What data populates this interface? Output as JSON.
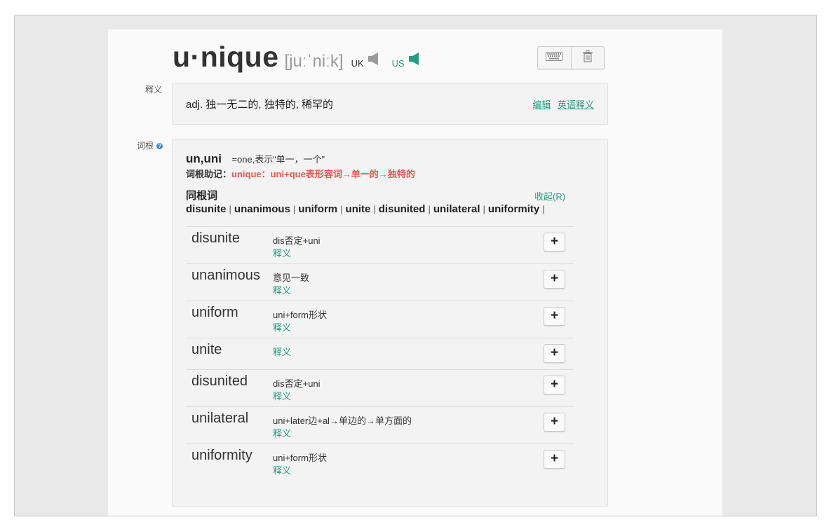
{
  "word": {
    "text": "u·nique",
    "phonetic": "[juːˈniːk]",
    "uk_label": "UK",
    "us_label": "US"
  },
  "toolbar": {
    "keyboard_icon": "keyboard-icon",
    "delete_icon": "trash-icon"
  },
  "definition": {
    "section_label": "释义",
    "text": "adj. 独一无二的, 独特的, 稀罕的",
    "edit_link": "编辑",
    "english_link": "英语释义"
  },
  "root": {
    "section_label": "词根",
    "name": "un,uni",
    "meaning": "=one,表示“单一，一个”",
    "memo_label": "词根助记：",
    "memo_text": "unique：uni+que表形容词→单一的→独特的",
    "cognates_label": "同根词",
    "cognates": [
      "disunite",
      "unanimous",
      "uniform",
      "unite",
      "disunited",
      "unilateral",
      "uniformity"
    ],
    "separator": "|",
    "collapse_link": "收起(R)"
  },
  "rows": [
    {
      "word": "disunite",
      "etymology": "dis否定+uni",
      "meaning_link": "释义",
      "add": "+"
    },
    {
      "word": "unanimous",
      "etymology": "意见一致",
      "meaning_link": "释义",
      "add": "+"
    },
    {
      "word": "uniform",
      "etymology": "uni+form形状",
      "meaning_link": "释义",
      "add": "+"
    },
    {
      "word": "unite",
      "etymology": "",
      "meaning_link": "释义",
      "add": "+"
    },
    {
      "word": "disunited",
      "etymology": "dis否定+uni",
      "meaning_link": "释义",
      "add": "+"
    },
    {
      "word": "unilateral",
      "etymology": "uni+later边+al→单边的→单方面的",
      "meaning_link": "释义",
      "add": "+"
    },
    {
      "word": "uniformity",
      "etymology": "uni+form形状",
      "meaning_link": "释义",
      "add": "+"
    }
  ],
  "colors": {
    "accent_green": "#239b7c",
    "memo_red": "#e8544e",
    "help_blue": "#3a8ad0"
  }
}
